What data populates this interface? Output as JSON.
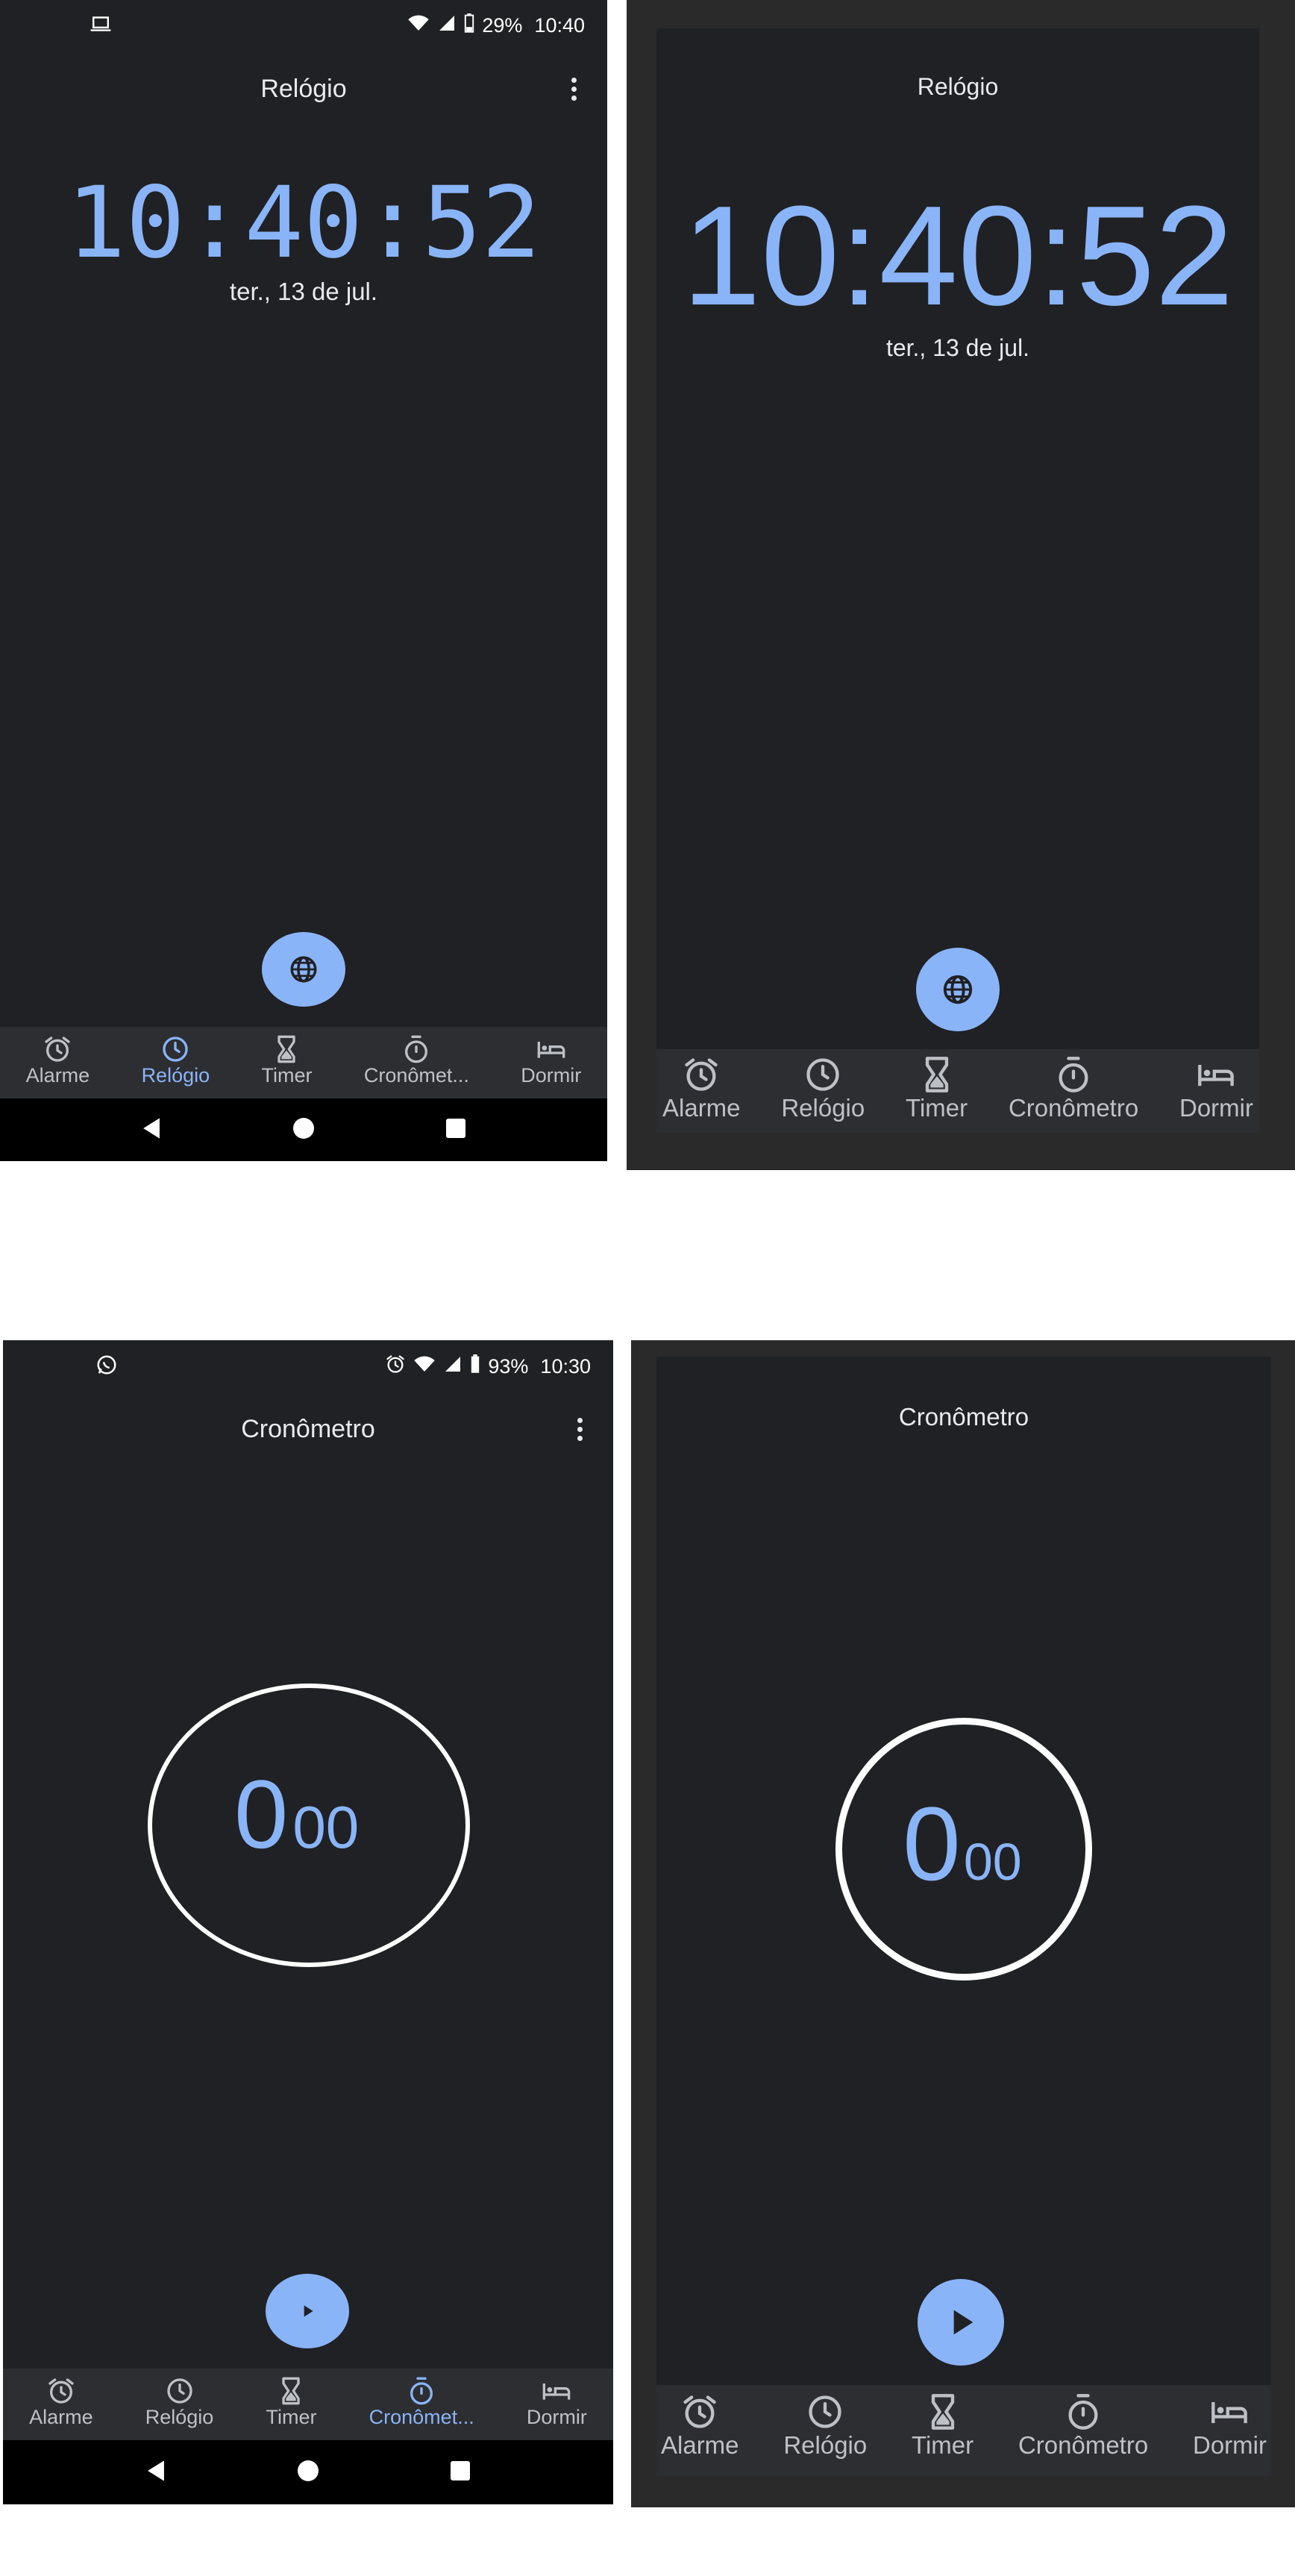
{
  "panels": {
    "clock_phone": {
      "status": {
        "time": "10:40",
        "battery": "29%"
      },
      "title": "Relógio",
      "clock_time": "10:40:52",
      "date": "ter., 13 de jul."
    },
    "clock_mock": {
      "title": "Relógio",
      "clock_time": "10:40:52",
      "date": "ter., 13 de jul."
    },
    "stopwatch_phone": {
      "status": {
        "time": "10:30",
        "battery": "93%"
      },
      "title": "Cronômetro",
      "seconds": "0",
      "hundredths": "00"
    },
    "stopwatch_mock": {
      "title": "Cronômetro",
      "seconds": "0",
      "hundredths": "00"
    }
  },
  "tabs_truncated": [
    "Alarme",
    "Relógio",
    "Timer",
    "Cronômet...",
    "Dormir"
  ],
  "tabs_full": [
    "Alarme",
    "Relógio",
    "Timer",
    "Cronômetro",
    "Dormir"
  ],
  "tab_icons": [
    "alarm-clock-icon",
    "clock-icon",
    "hourglass-icon",
    "stopwatch-icon",
    "bed-icon"
  ],
  "nav_icons": [
    "back-icon",
    "home-icon",
    "recents-icon"
  ],
  "colors": {
    "background": "#202124",
    "accent": "#8ab4f8",
    "tabbar": "#2d2e31",
    "text": "#e8eaed",
    "tab_inactive": "#bdc1c6"
  }
}
